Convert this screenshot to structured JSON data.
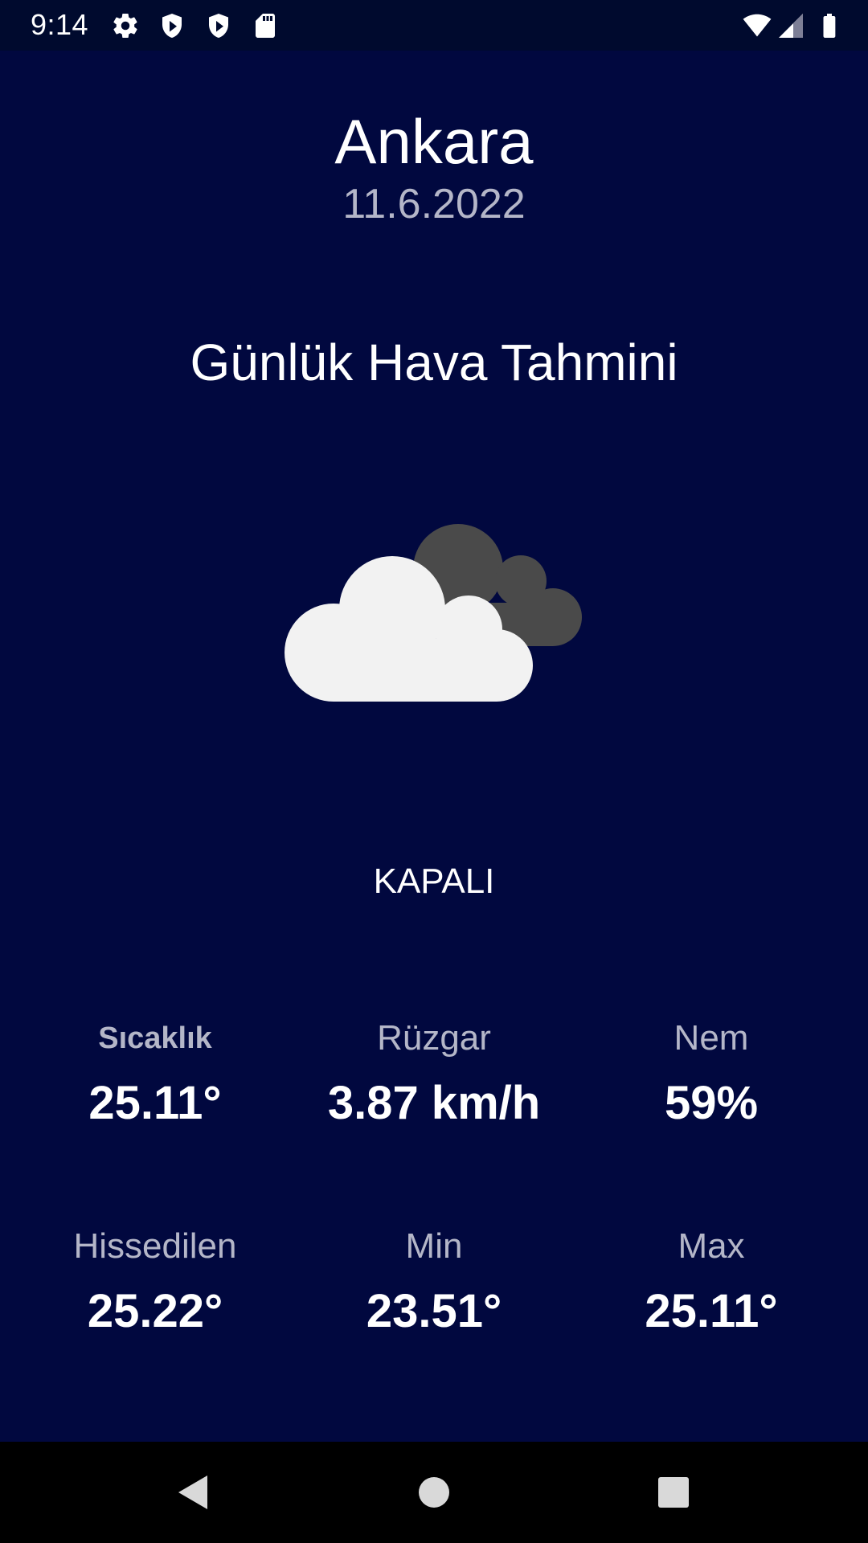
{
  "status_bar": {
    "time": "9:14",
    "icons": [
      "settings-icon",
      "shield-icon",
      "shield-icon",
      "sd-card-icon",
      "wifi-icon",
      "cell-signal-icon",
      "battery-icon"
    ]
  },
  "header": {
    "city": "Ankara",
    "date": "11.6.2022"
  },
  "forecast": {
    "title": "Günlük Hava Tahmini",
    "icon": "cloudy-icon",
    "condition": "KAPALI"
  },
  "stats": {
    "temperature": {
      "label": "Sıcaklık",
      "value": "25.11°"
    },
    "wind": {
      "label": "Rüzgar",
      "value": "3.87 km/h"
    },
    "humidity": {
      "label": "Nem",
      "value": "59%"
    },
    "feels_like": {
      "label": "Hissedilen",
      "value": "25.22°"
    },
    "min": {
      "label": "Min",
      "value": "23.51°"
    },
    "max": {
      "label": "Max",
      "value": "25.11°"
    }
  },
  "navigation": {
    "icons": [
      "back-icon",
      "home-icon",
      "recents-icon"
    ]
  },
  "colors": {
    "background": "#01083f",
    "status_bar": "#000a2e",
    "muted_text": "#b4b6c8",
    "cloud_front": "#f2f2f2",
    "cloud_back": "#4a4a4a"
  }
}
